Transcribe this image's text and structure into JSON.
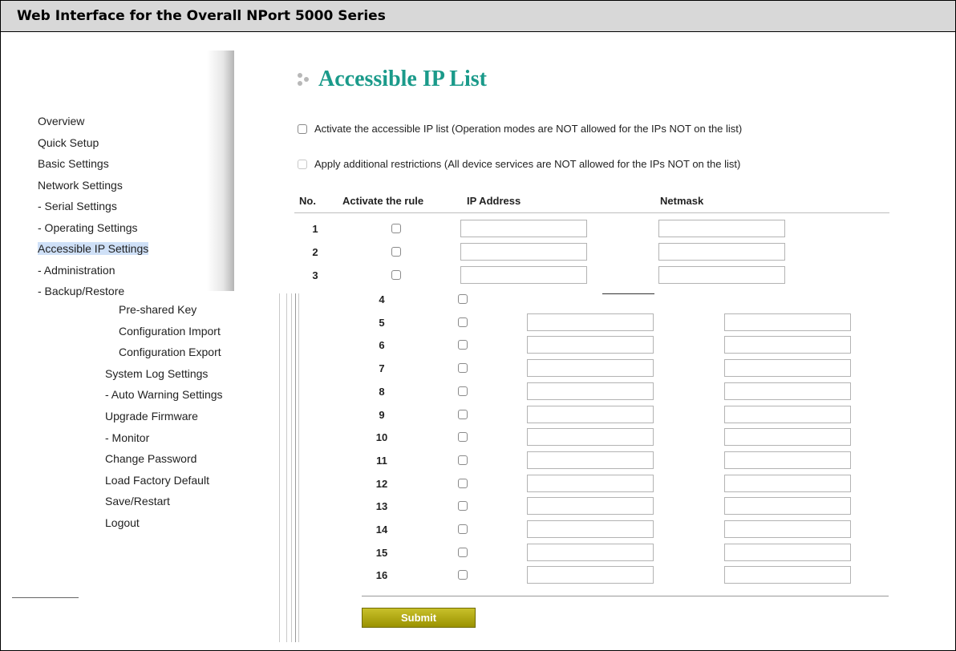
{
  "window": {
    "title": "Web Interface for the Overall NPort 5000 Series"
  },
  "upper_nav": [
    {
      "label": "Overview"
    },
    {
      "label": "Quick Setup"
    },
    {
      "label": "Basic Settings"
    },
    {
      "label": "Network Settings"
    },
    {
      "label": "- Serial Settings"
    },
    {
      "label": "- Operating Settings"
    },
    {
      "label": "Accessible IP Settings",
      "active": true
    },
    {
      "label": "- Administration"
    },
    {
      "label": "- Backup/Restore"
    }
  ],
  "lower_nav": [
    {
      "label": "Pre-shared Key",
      "sub": true
    },
    {
      "label": "Configuration Import",
      "sub": true
    },
    {
      "label": "Configuration Export",
      "sub": true
    },
    {
      "label": "System Log Settings",
      "sub": false
    },
    {
      "label": "- Auto Warning Settings",
      "sub": false
    },
    {
      "label": "Upgrade Firmware",
      "sub": false
    },
    {
      "label": "- Monitor",
      "sub": false
    },
    {
      "label": "Change Password",
      "sub": false
    },
    {
      "label": "Load Factory Default",
      "sub": false
    },
    {
      "label": "Save/Restart",
      "sub": false
    },
    {
      "label": "Logout",
      "sub": false
    }
  ],
  "page": {
    "title": "Accessible IP List"
  },
  "options": {
    "activate_list": {
      "label": "Activate the accessible IP list (Operation modes are NOT allowed for the IPs NOT on the list)",
      "checked": false
    },
    "additional_restrictions": {
      "label": "Apply additional restrictions (All device services are NOT allowed for the IPs NOT on the list)",
      "checked": false,
      "disabled": true
    }
  },
  "table": {
    "headers": {
      "no": "No.",
      "activate": "Activate the rule",
      "ip": "IP Address",
      "netmask": "Netmask"
    },
    "rows": [
      {
        "no": "1",
        "ip": "",
        "netmask": ""
      },
      {
        "no": "2",
        "ip": "",
        "netmask": ""
      },
      {
        "no": "3",
        "ip": "",
        "netmask": ""
      },
      {
        "no": "4",
        "ip": "",
        "netmask": ""
      },
      {
        "no": "5",
        "ip": "",
        "netmask": ""
      },
      {
        "no": "6",
        "ip": "",
        "netmask": ""
      },
      {
        "no": "7",
        "ip": "",
        "netmask": ""
      },
      {
        "no": "8",
        "ip": "",
        "netmask": ""
      },
      {
        "no": "9",
        "ip": "",
        "netmask": ""
      },
      {
        "no": "10",
        "ip": "",
        "netmask": ""
      },
      {
        "no": "11",
        "ip": "",
        "netmask": ""
      },
      {
        "no": "12",
        "ip": "",
        "netmask": ""
      },
      {
        "no": "13",
        "ip": "",
        "netmask": ""
      },
      {
        "no": "14",
        "ip": "",
        "netmask": ""
      },
      {
        "no": "15",
        "ip": "",
        "netmask": ""
      },
      {
        "no": "16",
        "ip": "",
        "netmask": ""
      }
    ]
  },
  "submit": {
    "label": "Submit"
  },
  "colors": {
    "title": "#1a9a8a",
    "submit": "#a9a100",
    "active_nav": "#cfe0f7"
  }
}
